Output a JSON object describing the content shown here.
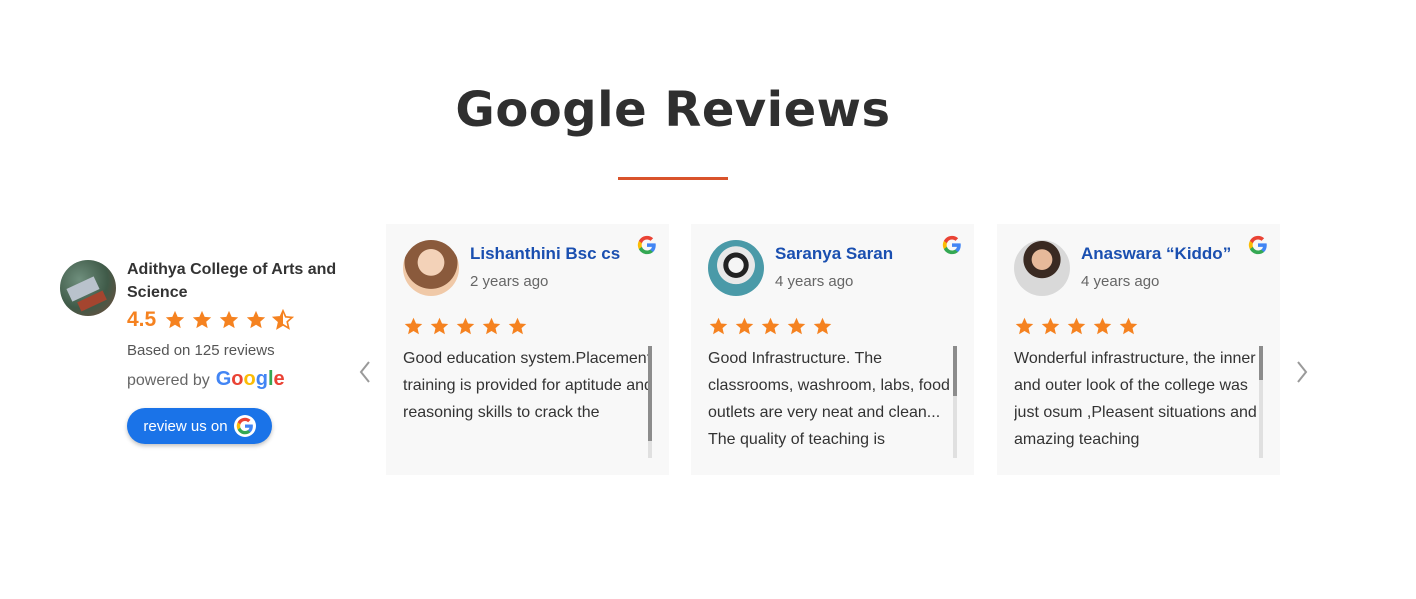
{
  "page": {
    "title": "Google Reviews"
  },
  "colors": {
    "accent": "#d9532b",
    "star": "#f58220",
    "link": "#1a4fb0",
    "button": "#1a73e8"
  },
  "summary": {
    "business_name": "Adithya College of Arts and Science",
    "rating": "4.5",
    "rating_value": 4.5,
    "based_on": "Based on 125 reviews",
    "powered_by": "powered by",
    "google_word": [
      "G",
      "o",
      "o",
      "g",
      "l",
      "e"
    ],
    "review_button": "review us on"
  },
  "navigation": {
    "prev_icon": "chevron-left-icon",
    "next_icon": "chevron-right-icon"
  },
  "reviews": [
    {
      "name": "Lishanthini Bsc cs",
      "time": "2 years ago",
      "rating": 5,
      "text": "Good education system.Placement training is provided for aptitude and reasoning skills to crack the",
      "scroll_fraction": 0.85
    },
    {
      "name": "Saranya Saran",
      "time": "4 years ago",
      "rating": 5,
      "text": "Good Infrastructure. The classrooms, washroom, labs, food outlets are very neat and clean... The quality of teaching is",
      "scroll_fraction": 0.45
    },
    {
      "name": "Anaswara “Kiddo”",
      "time": "4 years ago",
      "rating": 5,
      "text": "Wonderful infrastructure, the inner and outer look of the college was just osum ,Pleasent situations and amazing teaching",
      "scroll_fraction": 0.3
    }
  ]
}
